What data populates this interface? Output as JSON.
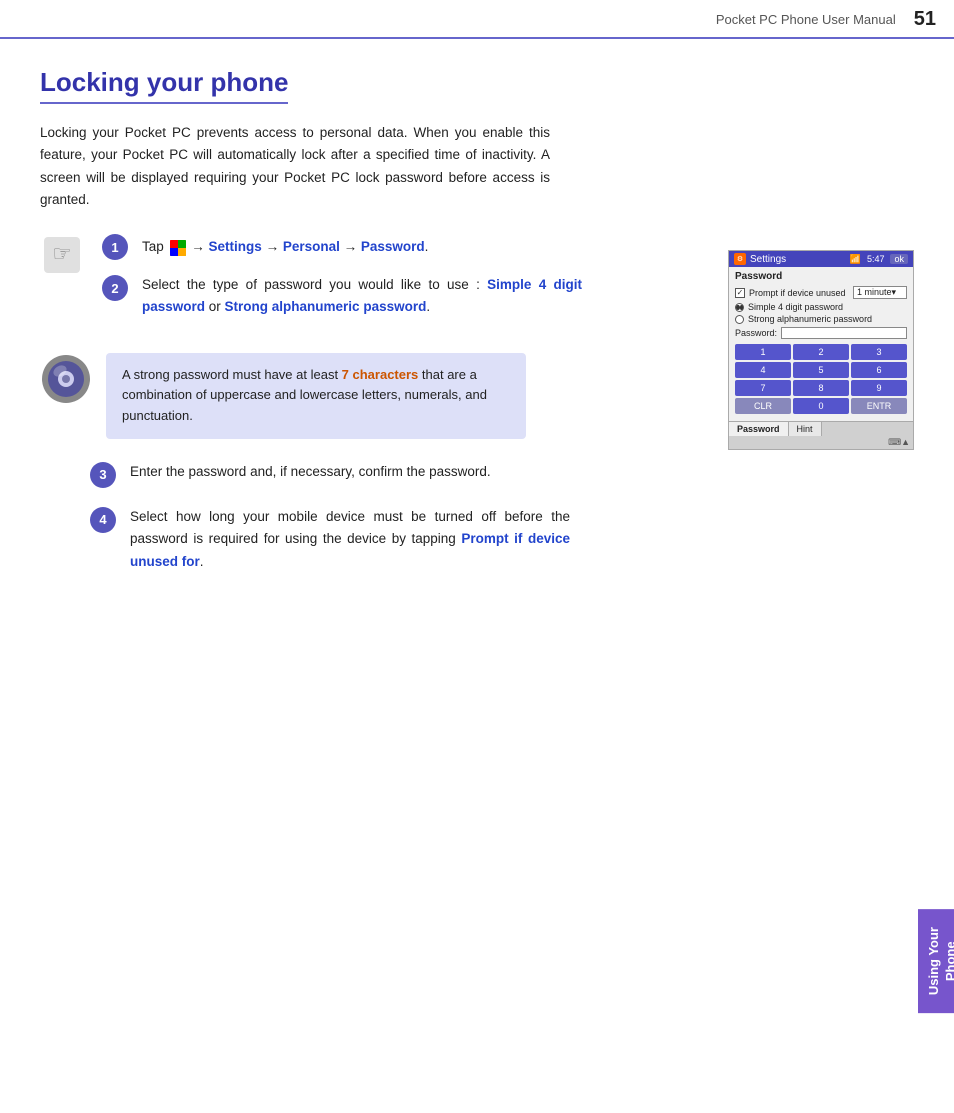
{
  "header": {
    "title": "Pocket PC Phone User Manual",
    "page_number": "51"
  },
  "page": {
    "heading": "Locking your phone",
    "intro": "Locking your Pocket PC prevents access to personal data. When you enable this feature, your Pocket PC will automatically lock after a specified time of inactivity. A screen will be displayed requiring your Pocket PC lock password before access is granted.",
    "steps": [
      {
        "number": "1",
        "text_parts": [
          {
            "text": "Tap ",
            "style": "normal"
          },
          {
            "text": " → ",
            "style": "normal"
          },
          {
            "text": "Settings",
            "style": "blue"
          },
          {
            "text": " → ",
            "style": "normal"
          },
          {
            "text": "Personal",
            "style": "blue"
          },
          {
            "text": " → ",
            "style": "normal"
          },
          {
            "text": "Password",
            "style": "blue"
          },
          {
            "text": ".",
            "style": "normal"
          }
        ]
      },
      {
        "number": "2",
        "text_parts": [
          {
            "text": "Select the type of password you would like to use : ",
            "style": "normal"
          },
          {
            "text": "Simple 4 digit password",
            "style": "blue"
          },
          {
            "text": " or ",
            "style": "normal"
          },
          {
            "text": "Strong alphanumeric password",
            "style": "blue"
          },
          {
            "text": ".",
            "style": "normal"
          }
        ]
      },
      {
        "number": "3",
        "text": "Enter the password and, if necessary, confirm the password."
      },
      {
        "number": "4",
        "text_parts": [
          {
            "text": "Select  how long your mobile device must be turned off before the password is required for using the device by tapping ",
            "style": "normal"
          },
          {
            "text": "Prompt if device unused for",
            "style": "blue"
          },
          {
            "text": ".",
            "style": "normal"
          }
        ]
      }
    ],
    "tip": {
      "text_parts": [
        {
          "text": "A strong password must have at least ",
          "style": "normal"
        },
        {
          "text": "7 characters",
          "style": "orange"
        },
        {
          "text": " that are a combination of uppercase and lowercase letters, numerals, and punctuation.",
          "style": "normal"
        }
      ]
    }
  },
  "screenshot": {
    "title": "Settings",
    "time": "5:47",
    "section": "Password",
    "prompt_label": "Prompt if device unused",
    "prompt_value": "1 minute",
    "radio_simple": "Simple 4 digit password",
    "radio_strong": "Strong alphanumeric password",
    "password_label": "Password:",
    "numpad": [
      "1",
      "2",
      "3",
      "4",
      "5",
      "6",
      "7",
      "8",
      "9",
      "CLR",
      "0",
      "ENTR"
    ],
    "tab_password": "Password",
    "tab_hint": "Hint"
  },
  "side_tab": {
    "line1": "Using Your",
    "line2": "Phone"
  }
}
